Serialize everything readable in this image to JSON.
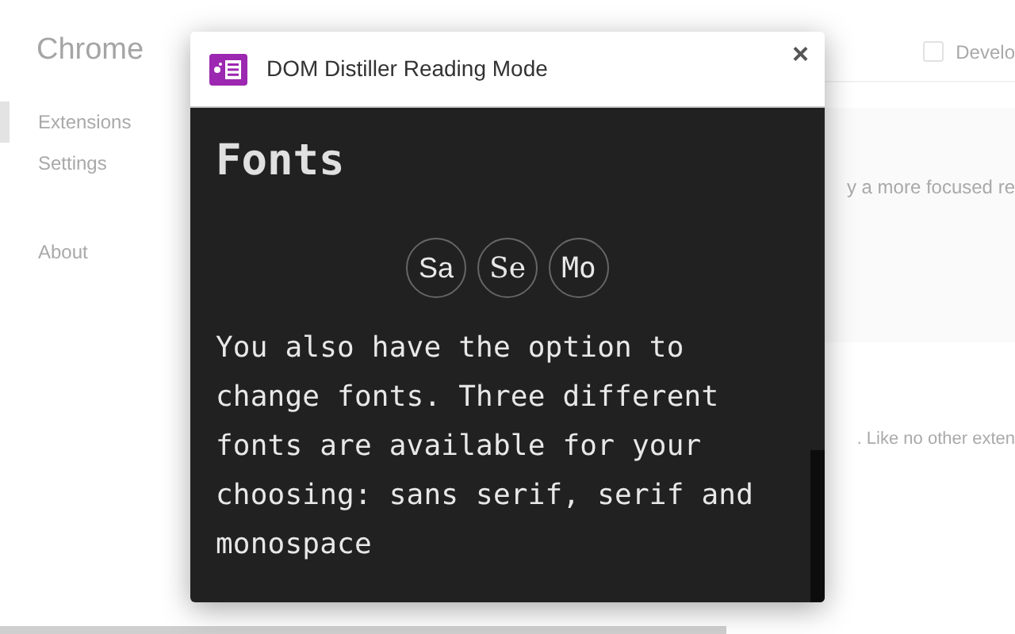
{
  "background_page": {
    "brand": "Chrome",
    "sidebar": {
      "items": [
        {
          "label": "Extensions",
          "selected": true
        },
        {
          "label": "Settings",
          "selected": false
        },
        {
          "label": "About",
          "selected": false
        }
      ]
    },
    "developer_mode": {
      "label": "Develo",
      "checked": false
    },
    "snippets": [
      "y a more focused re",
      ". Like no other exten"
    ]
  },
  "popup": {
    "title": "DOM Distiller Reading Mode",
    "close": "×",
    "heading": "Fonts",
    "font_buttons": [
      {
        "label": "Sa",
        "kind": "sans"
      },
      {
        "label": "Se",
        "kind": "serif"
      },
      {
        "label": "Mo",
        "kind": "mono"
      }
    ],
    "text": "You also have the option to change fonts. Three different fonts are available for your choosing: sans serif, serif and monospace"
  }
}
